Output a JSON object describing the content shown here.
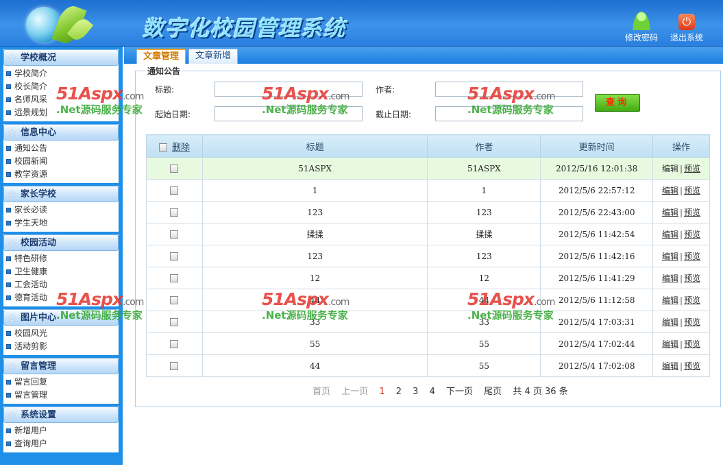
{
  "app": {
    "title": "数字化校园管理系统"
  },
  "header": {
    "change_password": "修改密码",
    "logout": "退出系统"
  },
  "sidebar": {
    "groups": [
      {
        "title": "学校概况",
        "items": [
          "学校简介",
          "校长简介",
          "名师风采",
          "远景规划"
        ]
      },
      {
        "title": "信息中心",
        "items": [
          "通知公告",
          "校园新闻",
          "教学资源"
        ]
      },
      {
        "title": "家长学校",
        "items": [
          "家长必读",
          "学生天地"
        ]
      },
      {
        "title": "校园活动",
        "items": [
          "特色研修",
          "卫生健康",
          "工会活动",
          "德育活动"
        ]
      },
      {
        "title": "图片中心",
        "items": [
          "校园风光",
          "活动剪影"
        ]
      },
      {
        "title": "留言管理",
        "items": [
          "留言回复",
          "留言管理"
        ]
      },
      {
        "title": "系统设置",
        "items": [
          "新增用户",
          "查询用户"
        ]
      }
    ]
  },
  "tabs": [
    {
      "label": "文章管理",
      "active": true
    },
    {
      "label": "文章新增",
      "active": false
    }
  ],
  "search": {
    "legend": "通知公告",
    "title_label": "标题:",
    "author_label": "作者:",
    "start_label": "起始日期:",
    "end_label": "截止日期:",
    "title_value": "",
    "author_value": "",
    "start_value": "",
    "end_value": "",
    "button": "查询"
  },
  "table": {
    "headers": {
      "delete": "删除",
      "title": "标题",
      "author": "作者",
      "updated": "更新时间",
      "ops": "操作"
    },
    "edit_label": "编辑",
    "preview_label": "预览",
    "rows": [
      {
        "title": "51ASPX",
        "author": "51ASPX",
        "updated": "2012/5/16 12:01:38",
        "highlight": true
      },
      {
        "title": "1",
        "author": "1",
        "updated": "2012/5/6 22:57:12"
      },
      {
        "title": "123",
        "author": "123",
        "updated": "2012/5/6 22:43:00"
      },
      {
        "title": "揉揉",
        "author": "揉揉",
        "updated": "2012/5/6 11:42:54"
      },
      {
        "title": "123",
        "author": "123",
        "updated": "2012/5/6 11:42:16"
      },
      {
        "title": "12",
        "author": "12",
        "updated": "2012/5/6 11:41:29"
      },
      {
        "title": "44",
        "author": "44",
        "updated": "2012/5/6 11:12:58"
      },
      {
        "title": "33",
        "author": "33",
        "updated": "2012/5/4 17:03:31"
      },
      {
        "title": "55",
        "author": "55",
        "updated": "2012/5/4 17:02:44"
      },
      {
        "title": "44",
        "author": "55",
        "updated": "2012/5/4 17:02:08"
      }
    ]
  },
  "pager": {
    "first": "首页",
    "prev": "上一页",
    "pages": [
      "1",
      "2",
      "3",
      "4"
    ],
    "current": "1",
    "next": "下一页",
    "last": "尾页",
    "summary": "共 4 页 36 条"
  },
  "watermark": {
    "brand": "51Aspx",
    "suffix": ".com",
    "tagline": ".Net源码服务专家"
  },
  "colors": {
    "header_blue": "#2a7fdf",
    "sidebar_blue": "#1f8fe8",
    "active_tab": "#d07a00",
    "query_button": "#42ab12",
    "current_page": "#d0220e",
    "highlight_row": "#e7fadf"
  }
}
